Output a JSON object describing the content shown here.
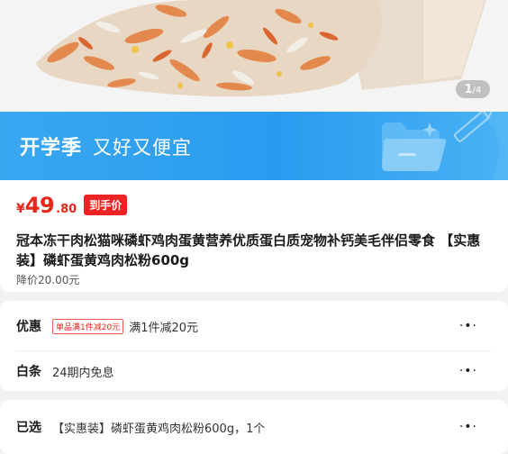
{
  "gallery": {
    "current": "1",
    "total": "/4"
  },
  "banner": {
    "main": "开学季",
    "sub": "又好又便宜",
    "bg_color": "#2a9bf0"
  },
  "price": {
    "currency": "¥",
    "integer": "49",
    "decimal": ".80",
    "tag": "到手价",
    "color": "#e8261a"
  },
  "product": {
    "title": "冠本冻干肉松猫咪磷虾鸡肉蛋黄营养优质蛋白质宠物补钙美毛伴侣零食 【实惠装】磷虾蛋黄鸡肉松粉600g",
    "price_drop": "降价20.00元"
  },
  "offer": {
    "label": "优惠",
    "coupon_tag": "单品满1件减20元",
    "text": "满1件减20元",
    "more_icon": "more-dots-icon"
  },
  "installment": {
    "label": "白条",
    "text": "24期内免息",
    "more_icon": "more-dots-icon"
  },
  "selection": {
    "label": "已选",
    "text": "【实惠装】磷虾蛋黄鸡肉松粉600g，1个",
    "more_icon": "more-dots-icon"
  }
}
